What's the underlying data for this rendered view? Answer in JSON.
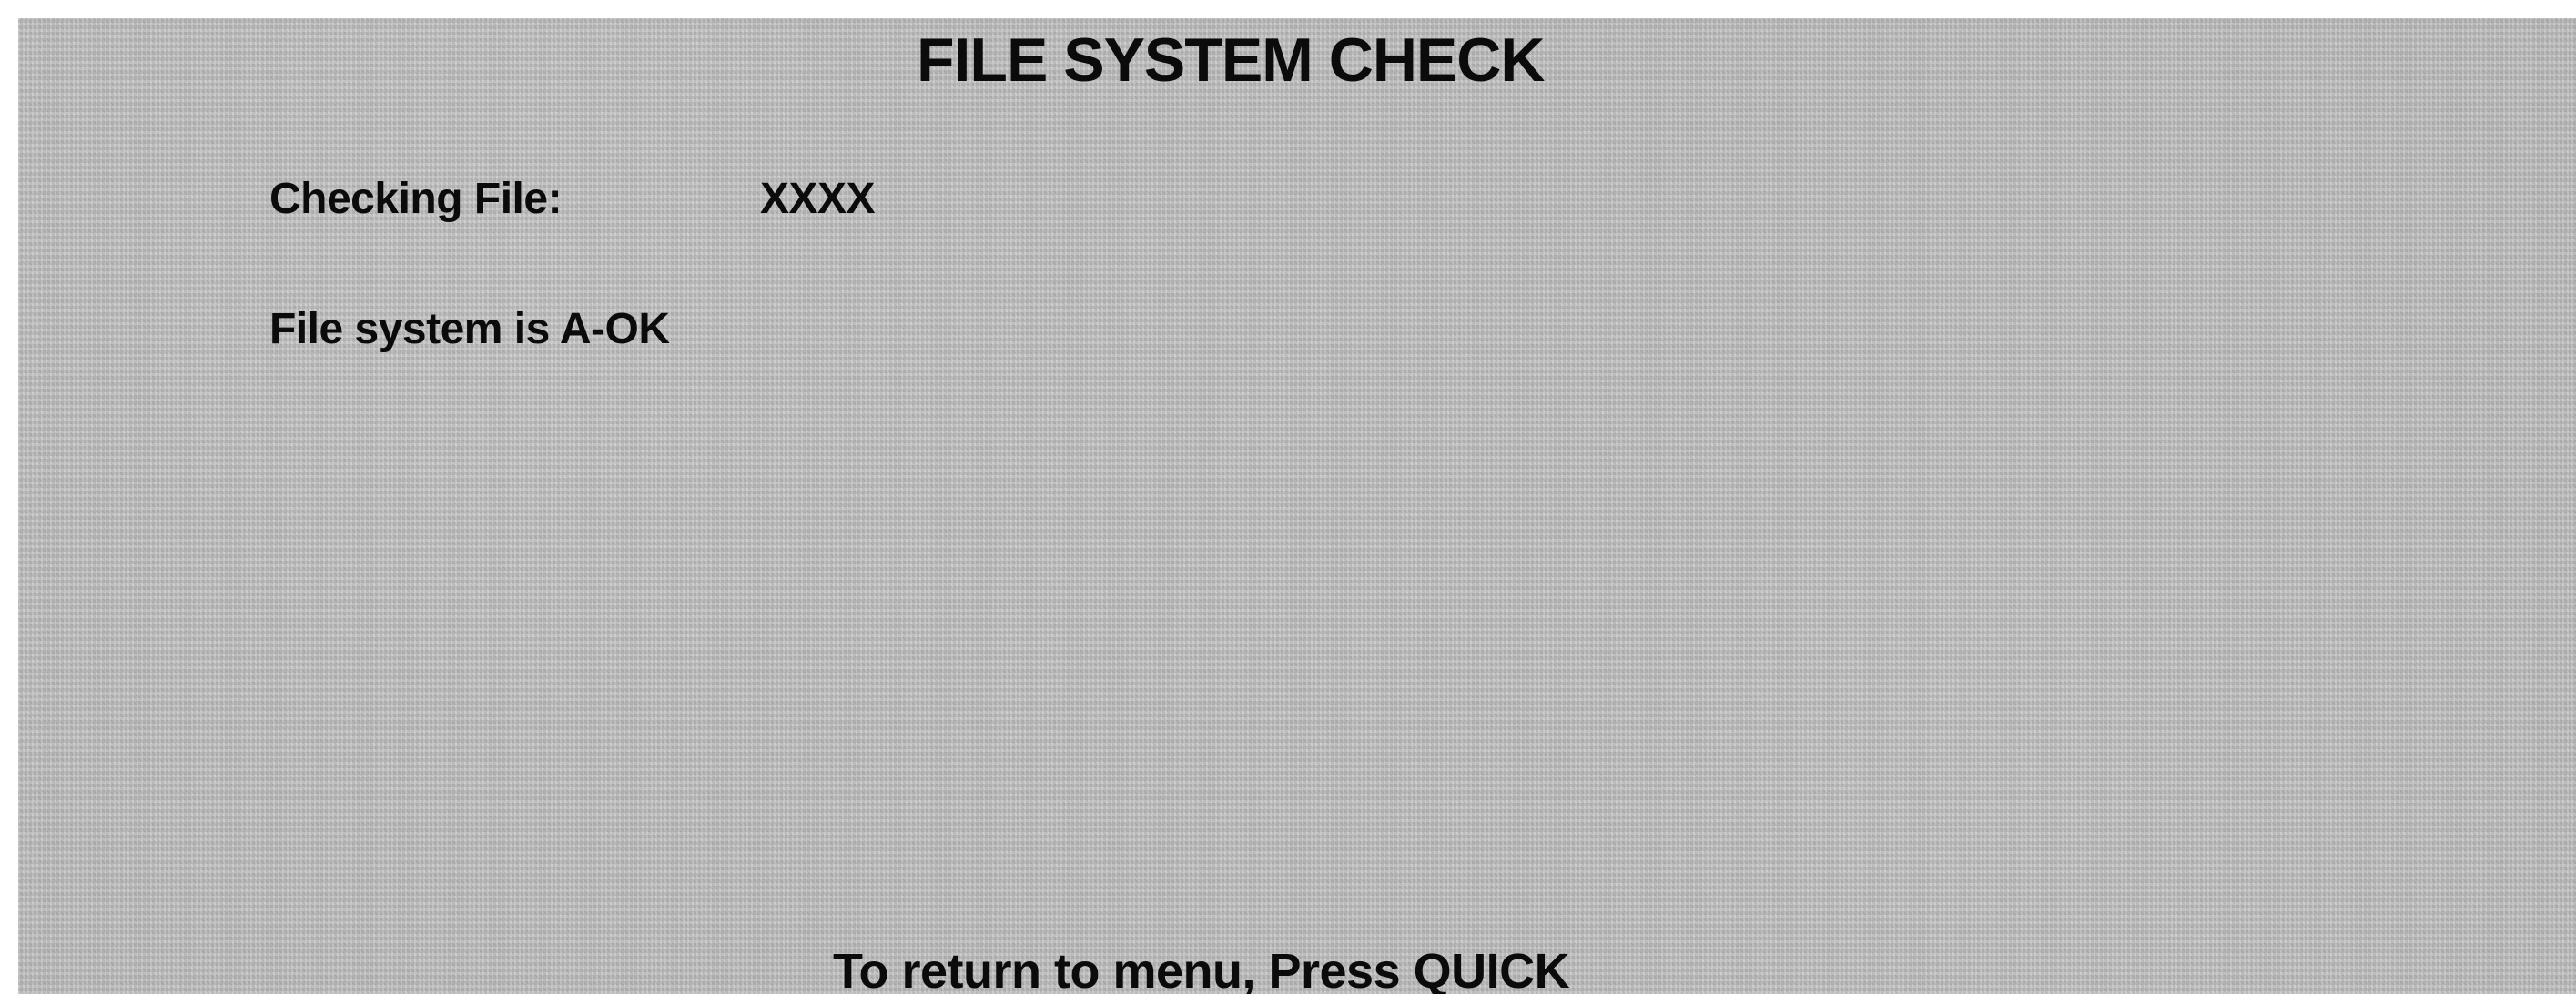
{
  "screen": {
    "title": "FILE SYSTEM CHECK",
    "checking": {
      "label": "Checking File:",
      "value": "XXXX"
    },
    "status": "File system is A-OK",
    "footer": "To return to menu, Press QUICK"
  },
  "colors": {
    "background": "#bdbdbd",
    "text": "#0b0b0b"
  }
}
